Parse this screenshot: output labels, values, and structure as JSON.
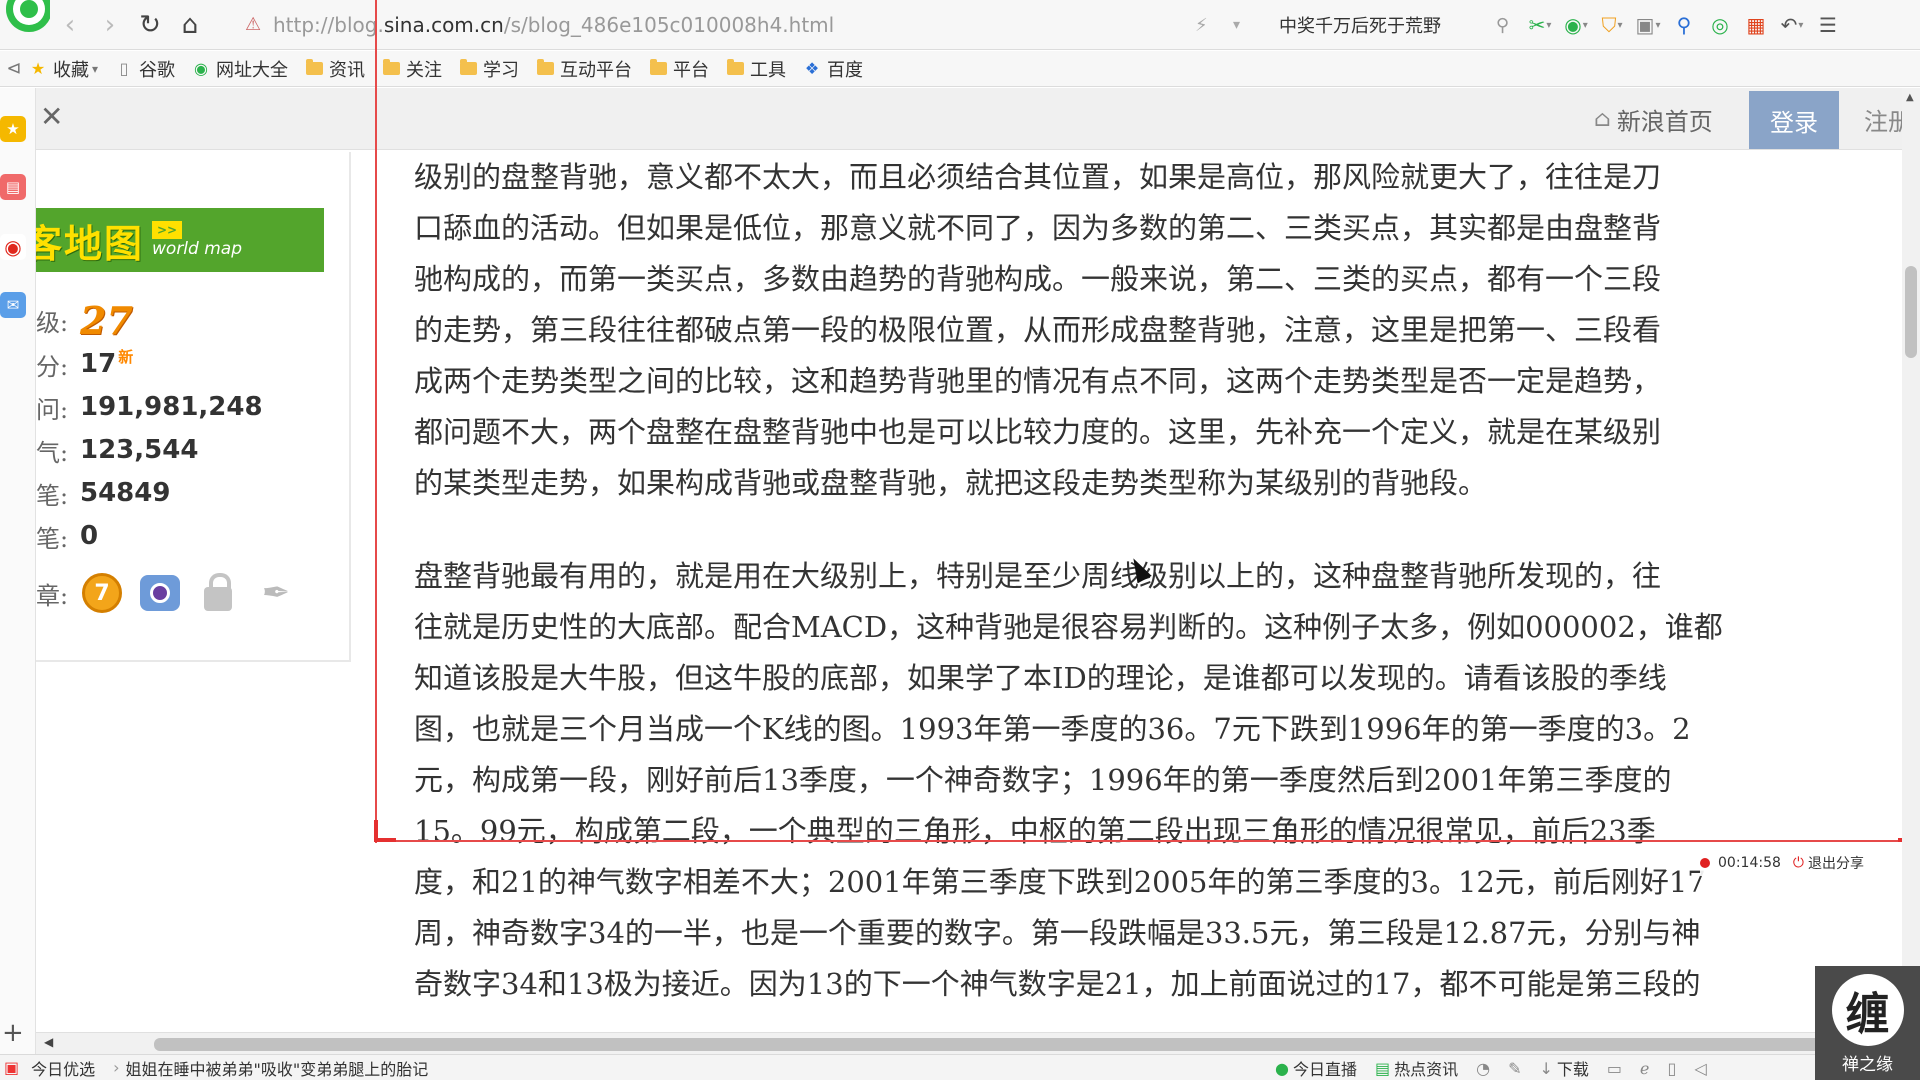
{
  "browser": {
    "url_prefix": "http://blog.",
    "url_domain": "sina.com.cn",
    "url_path": "/s/blog_486e105c010008h4.html",
    "search_text": "中奖千万后死于荒野"
  },
  "bookmarks": [
    {
      "label": "收藏",
      "icon": "star-icon"
    },
    {
      "label": "谷歌",
      "icon": "page-icon"
    },
    {
      "label": "网址大全",
      "icon": "globe-icon"
    },
    {
      "label": "资讯",
      "icon": "folder-icon"
    },
    {
      "label": "关注",
      "icon": "folder-icon"
    },
    {
      "label": "学习",
      "icon": "folder-icon"
    },
    {
      "label": "互动平台",
      "icon": "folder-icon"
    },
    {
      "label": "平台",
      "icon": "folder-icon"
    },
    {
      "label": "工具",
      "icon": "folder-icon"
    },
    {
      "label": "百度",
      "icon": "paw-icon"
    }
  ],
  "header": {
    "home_link": "新浪首页",
    "login": "登录",
    "register": "注册"
  },
  "profile": {
    "banner_title": "客地图",
    "banner_tag": "world map",
    "stats": [
      {
        "label": "级:",
        "value": "27"
      },
      {
        "label": "分:",
        "value": "17",
        "badge": "新"
      },
      {
        "label": "问:",
        "value": "191,981,248"
      },
      {
        "label": "气:",
        "value": "123,544"
      },
      {
        "label": "笔:",
        "value": "54849"
      },
      {
        "label": "笔:",
        "value": "0"
      },
      {
        "label": "章:",
        "medal_number": "7"
      }
    ]
  },
  "article": {
    "p1": [
      "级别的盘整背驰，意义都不太大，而且必须结合其位置，如果是高位，那风险就更大了，往往是刀",
      "口舔血的活动。但如果是低位，那意义就不同了，因为多数的第二、三类买点，其实都是由盘整背",
      "驰构成的，而第一类买点，多数由趋势的背驰构成。一般来说，第二、三类的买点，都有一个三段",
      "的走势，第三段往往都破点第一段的极限位置，从而形成盘整背驰，注意，这里是把第一、三段看",
      "成两个走势类型之间的比较，这和趋势背驰里的情况有点不同，这两个走势类型是否一定是趋势，",
      "都问题不大，两个盘整在盘整背驰中也是可以比较力度的。这里，先补充一个定义，就是在某级别",
      "的某类型走势，如果构成背驰或盘整背驰，就把这段走势类型称为某级别的背驰段。"
    ],
    "p2": [
      "盘整背驰最有用的，就是用在大级别上，特别是至少周线级别以上的，这种盘整背驰所发现的，往",
      "往就是历史性的大底部。配合MACD，这种背驰是很容易判断的。这种例子太多，例如000002，谁都",
      "知道该股是大牛股，但这牛股的底部，如果学了本ID的理论，是谁都可以发现的。请看该股的季线",
      "图，也就是三个月当成一个K线的图。1993年第一季度的36。7元下跌到1996年的第一季度的3。2",
      "元，构成第一段，刚好前后13季度，一个神奇数字；1996年的第一季度然后到2001年第三季度的",
      "15。99元，构成第二段，一个典型的三角形，中枢的第二段出现三角形的情况很常见，前后23季",
      "度，和21的神气数字相差不大；2001年第三季度下跌到2005年的第三季度的3。12元，前后刚好17",
      "周，神奇数字34的一半，也是一个重要的数字。第一段跌幅是33.5元，第三段是12.87元，分别与神",
      "奇数字34和13极为接近。因为13的下一个神气数字是21，加上前面说过的17，都不可能是第三段的"
    ]
  },
  "recording": {
    "time": "00:14:58",
    "exit": "退出分享"
  },
  "statusbar": {
    "left_label": "今日优选",
    "headline": "姐姐在睡中被弟弟\"吸收\"变弟弟腿上的胎记",
    "live": "今日直播",
    "hot": "热点资讯",
    "download": "下载"
  },
  "watermark": {
    "glyph": "缠",
    "caption": "禅之缘"
  },
  "colors": {
    "login_bg": "#8aa4c8",
    "selection": "#e64a4a",
    "banner_green": "#53a52c"
  }
}
